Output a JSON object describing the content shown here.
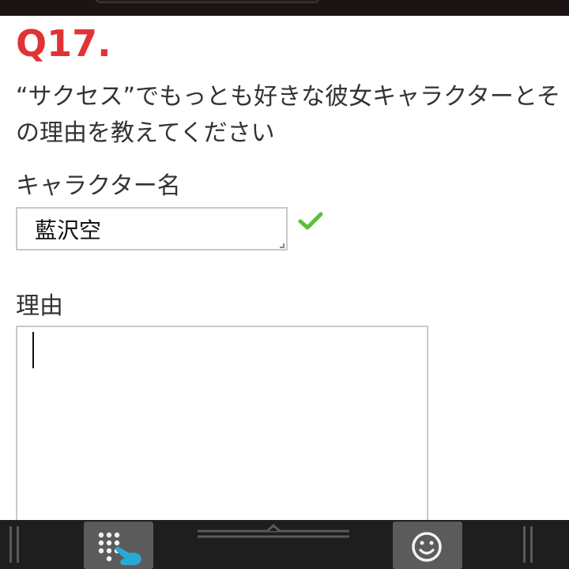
{
  "question": {
    "number": "Q17.",
    "text": "“サクセス”でもっとも好きな彼女キャラクターとその理由を教えてください"
  },
  "character_field": {
    "label": "キャラクター名",
    "value": "藍沢空",
    "status_icon": "check-icon",
    "status_color": "#5bbf3c"
  },
  "reason_field": {
    "label": "理由",
    "value": ""
  },
  "keyboard_bar": {
    "left_button_icon": "numpad-hand-icon",
    "right_button_icon": "smiley-icon",
    "accent_color": "#29a8d8"
  },
  "colors": {
    "question_number": "#e13236",
    "text": "#333333",
    "border": "#c9c9c9"
  }
}
